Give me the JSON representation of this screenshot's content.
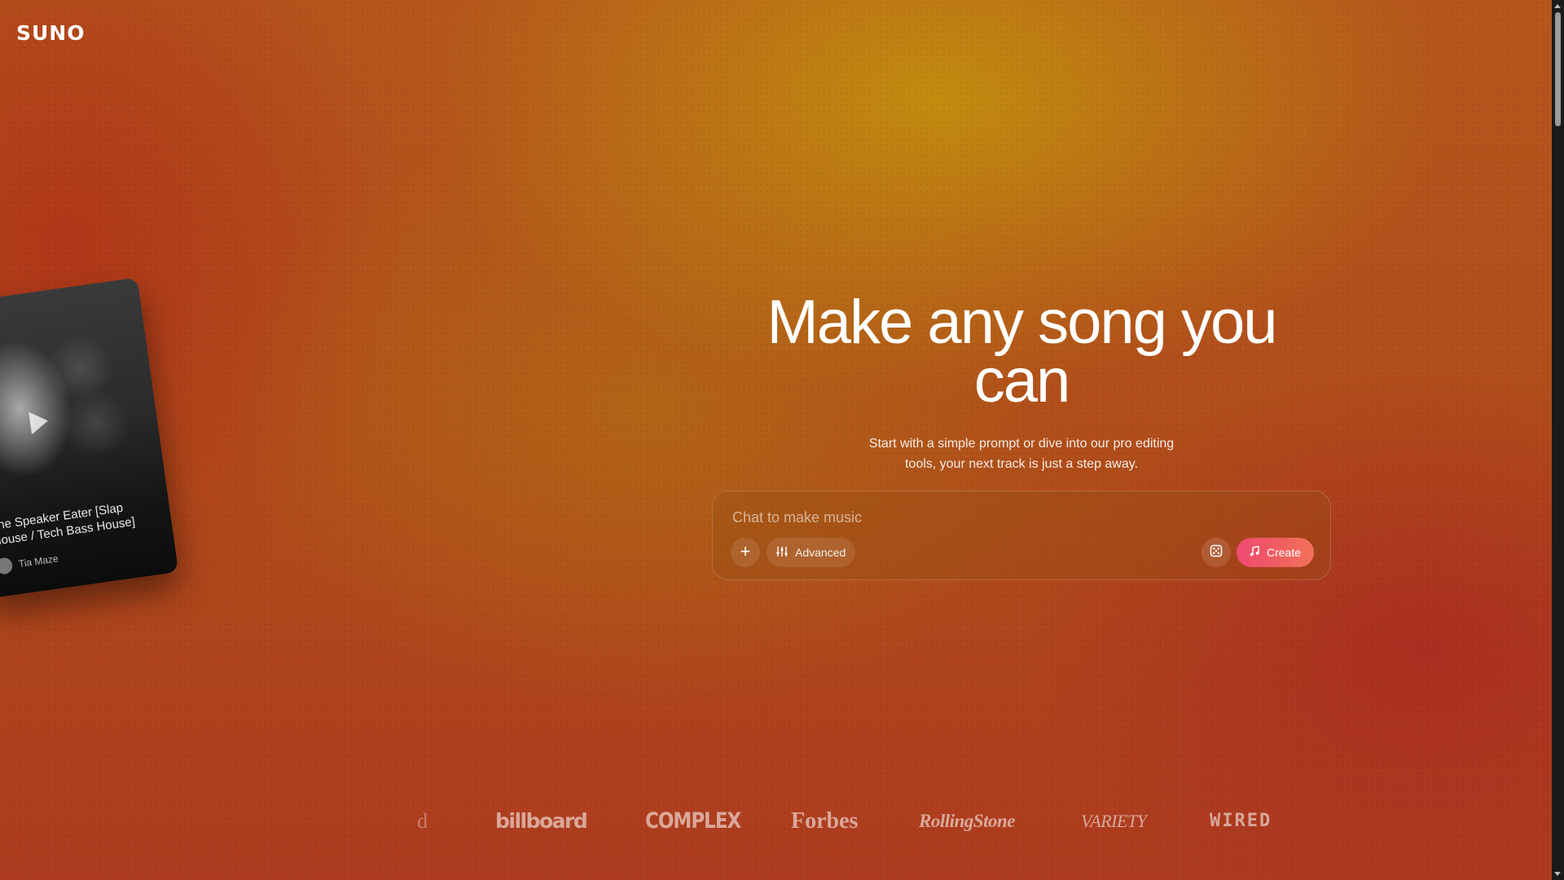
{
  "brand": {
    "logo_text": "SUNO"
  },
  "featured_card": {
    "title": "The Speaker Eater [Slap House / Tech Bass House]",
    "artist": "Tia Maze"
  },
  "hero": {
    "headline": "Make any song you can",
    "subtext": "Start with a simple prompt or dive into our pro editing tools, your next track is just a step away."
  },
  "prompt": {
    "placeholder": "Chat to make music",
    "add_label": "+",
    "advanced_label": "Advanced",
    "create_label": "Create"
  },
  "press_logos": {
    "partial": "d",
    "billboard": "billboard",
    "complex": "COMPLEX",
    "forbes": "Forbes",
    "rolling_stone": "RollingStone",
    "variety": "VARIETY",
    "wired": "WIRED"
  },
  "colors": {
    "accent_start": "#ef4a72",
    "accent_end": "#f2735b",
    "background_warm": "#b5561c",
    "background_gold": "#c4960c"
  }
}
